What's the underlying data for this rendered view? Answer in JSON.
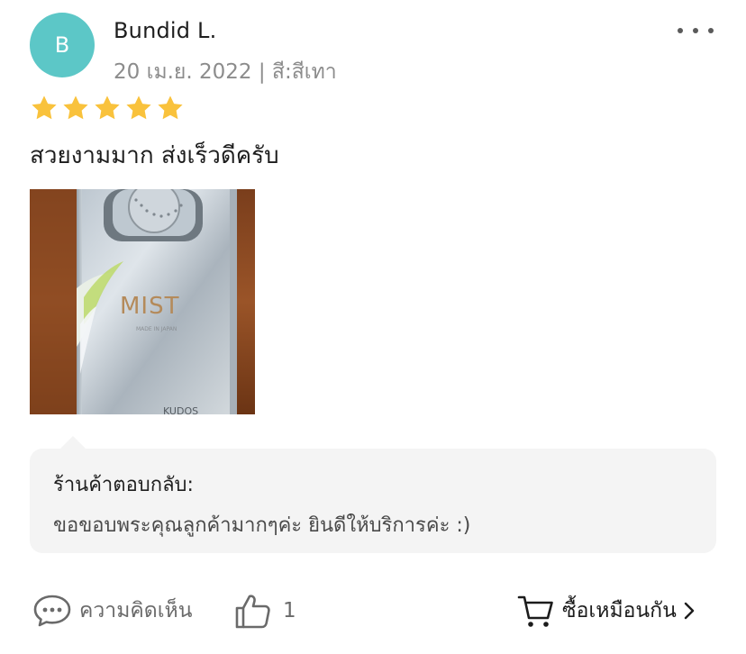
{
  "review": {
    "avatar_letter": "B",
    "avatar_color": "#5cc7c7",
    "username": "Bundid L.",
    "meta": "20 เม.ย. 2022 | สี:สีเทา",
    "rating": 5,
    "text": "สวยงามมาก ส่งเร็วดีครับ",
    "photo": {
      "brand": "MIST",
      "subtext": "MADE IN JAPAN",
      "maker": "KUDOS"
    }
  },
  "seller_reply": {
    "label": "ร้านค้าตอบกลับ:",
    "text": "ขอขอบพระคุณลูกค้ามากๆค่ะ ยินดีให้บริการค่ะ :)"
  },
  "actions": {
    "comment_label": "ความคิดเห็น",
    "like_count": "1",
    "buy_label": "ซื้อเหมือนกัน"
  },
  "colors": {
    "star": "#f9c23c",
    "reply_bg": "#f4f4f4"
  },
  "icons": [
    "more-icon",
    "star-icon",
    "comment-icon",
    "thumbs-up-icon",
    "cart-icon",
    "chevron-right-icon"
  ]
}
